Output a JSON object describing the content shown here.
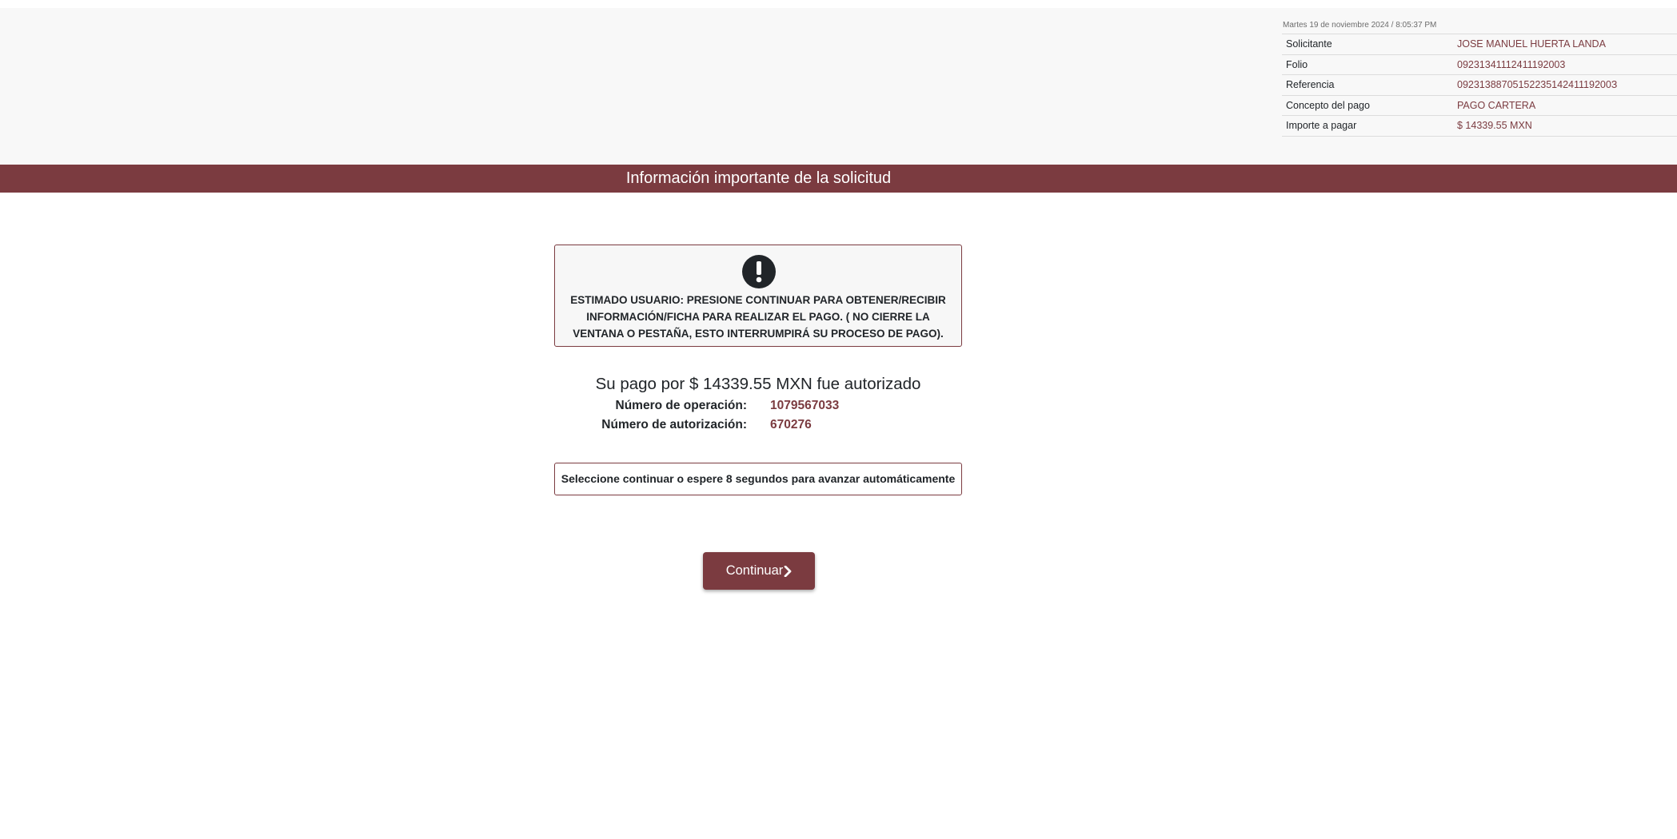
{
  "header": {
    "date": "Martes 19 de noviembre 2024 / 8:05:37 PM",
    "rows": [
      {
        "label": "Solicitante",
        "value": "JOSE MANUEL HUERTA LANDA"
      },
      {
        "label": "Folio",
        "value": "09231341112411192003"
      },
      {
        "label": "Referencia",
        "value": "0923138870515223514241119200З"
      },
      {
        "label": "Concepto del pago",
        "value": "PAGO CARTERA"
      },
      {
        "label": "Importe a pagar",
        "value": "$ 14339.55 MXN"
      }
    ]
  },
  "banner": {
    "title": "Información importante de la solicitud"
  },
  "alert": {
    "icon": "exclamation-circle-icon",
    "text": "ESTIMADO USUARIO: PRESIONE CONTINUAR PARA OBTENER/RECIBIR INFORMACIÓN/FICHA PARA REALIZAR EL PAGO. ( NO CIERRE LA VENTANA O PESTAÑA, ESTO INTERRUMPIRÁ SU PROCESO DE PAGO)."
  },
  "payment": {
    "summary": "Su pago por $ 14339.55 MXN fue autorizado",
    "operation_label": "Número de operación:",
    "operation_value": "1079567033",
    "authorization_label": "Número de autorización:",
    "authorization_value": "670276"
  },
  "notice": {
    "text": "Seleccione continuar o espere 8 segundos para avanzar automáticamente"
  },
  "actions": {
    "continue_label": "Continuar",
    "continue_icon": "chevron-right-icon"
  },
  "colors": {
    "brand": "#7b3b40",
    "header_bg": "#f8f8f8",
    "text": "#212529"
  }
}
